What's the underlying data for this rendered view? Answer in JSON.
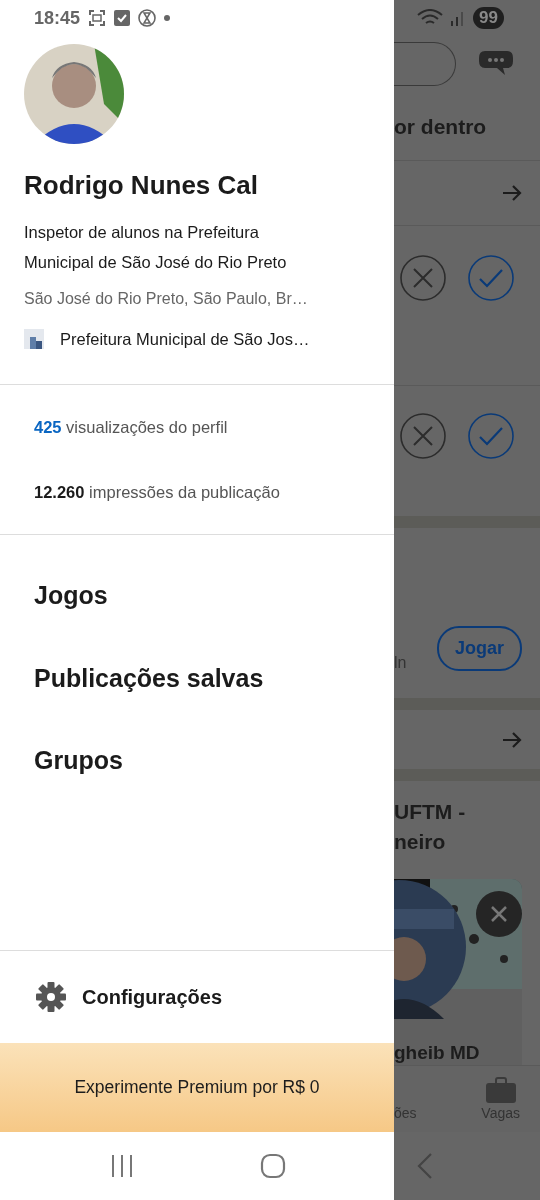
{
  "status_bar": {
    "time": "18:45",
    "battery": "99"
  },
  "drawer": {
    "profile": {
      "name": "Rodrigo Nunes Cal",
      "headline": "Inspetor de alunos na Prefeitura Municipal de São José do Rio Preto",
      "location": "São José do Rio Preto, São Paulo, Br…",
      "company": "Prefeitura Municipal de São Jos…"
    },
    "stats": [
      {
        "kind": "link",
        "value": "425",
        "label": "visualizações do perfil"
      },
      {
        "kind": "bold",
        "value": "12.260",
        "label": "impressões da publicação"
      }
    ],
    "menu": [
      "Jogos",
      "Publicações salvas",
      "Grupos"
    ],
    "settings": "Configurações",
    "premium": "Experimente Premium por R$ 0"
  },
  "background": {
    "heading": "or dentro",
    "invitations": [
      {
        "kind": "invite"
      },
      {
        "kind": "invite"
      }
    ],
    "game_text": "ln",
    "play_button": "Jogar",
    "post_title": [
      "UFTM -",
      "neiro"
    ],
    "card_name": "gheib MD",
    "tabs": [
      {
        "label": "ões",
        "kind": "text"
      },
      {
        "label": "Vagas",
        "kind": "briefcase"
      }
    ]
  }
}
